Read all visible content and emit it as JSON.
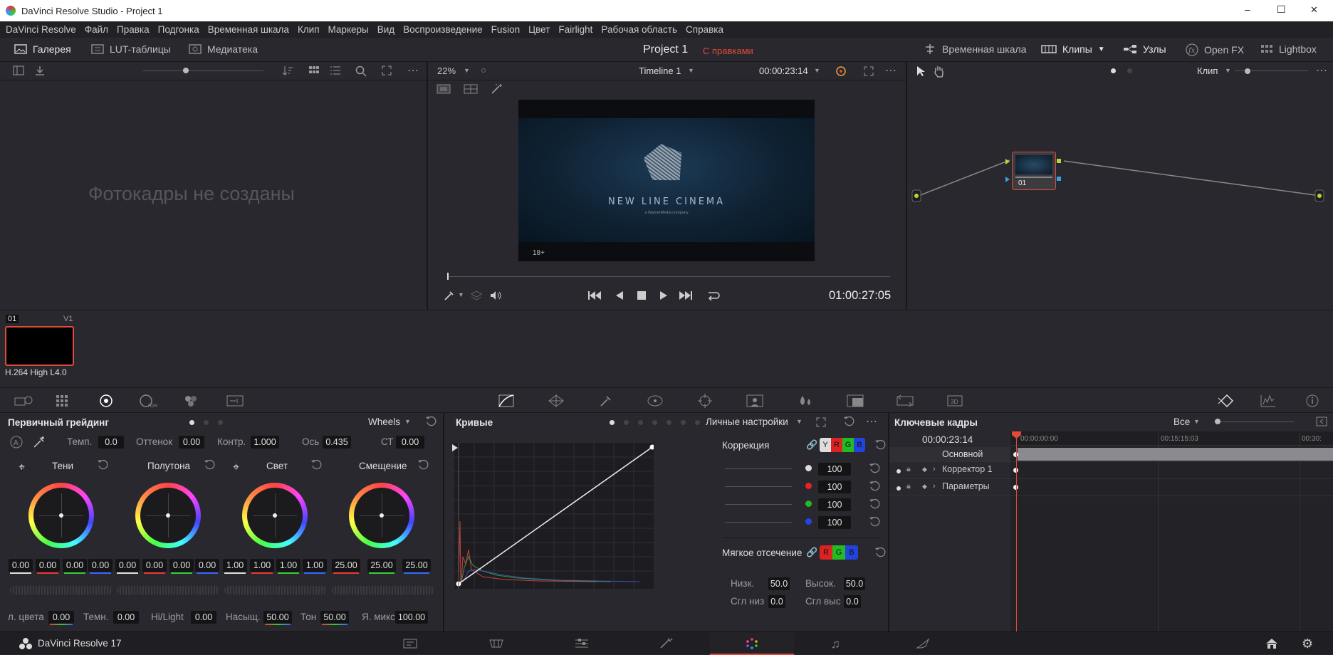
{
  "window": {
    "title": "DaVinci Resolve Studio - Project 1",
    "min": "–",
    "max": "☐",
    "close": "✕"
  },
  "menu": [
    "DaVinci Resolve",
    "Файл",
    "Правка",
    "Подгонка",
    "Временная шкала",
    "Клип",
    "Маркеры",
    "Вид",
    "Воспроизведение",
    "Fusion",
    "Цвет",
    "Fairlight",
    "Рабочая область",
    "Справка"
  ],
  "modebar": {
    "gallery": "Галерея",
    "lut": "LUT-таблицы",
    "media": "Медиатека",
    "project": "Project 1",
    "edited": "С правками",
    "timeline": "Временная шкала",
    "clips": "Клипы",
    "nodes": "Узлы",
    "openfx": "Open FX",
    "lightbox": "Lightbox"
  },
  "gallery": {
    "empty": "Фотокадры не созданы"
  },
  "viewer": {
    "zoom": "22%",
    "timeline_name": "Timeline 1",
    "timecode_top": "00:00:23:14",
    "timecode": "01:00:27:05",
    "logo": "NEW LINE CINEMA",
    "logo_sub": "a WarnerMedia company",
    "rating": "18+"
  },
  "nodes": {
    "mode": "Клип",
    "node_label": "01"
  },
  "clip": {
    "index": "01",
    "track": "V1",
    "codec": "H.264 High L4.0"
  },
  "primaries": {
    "title": "Первичный грейдинг",
    "mode": "Wheels",
    "params": [
      {
        "label": "Темп.",
        "value": "0.0"
      },
      {
        "label": "Оттенок",
        "value": "0.00"
      },
      {
        "label": "Контр.",
        "value": "1.000"
      },
      {
        "label": "Ось",
        "value": "0.435"
      },
      {
        "label": "СТ",
        "value": "0.00"
      }
    ],
    "wheels": [
      {
        "name": "Тени",
        "values": [
          "0.00",
          "0.00",
          "0.00",
          "0.00"
        ]
      },
      {
        "name": "Полутона",
        "values": [
          "0.00",
          "0.00",
          "0.00",
          "0.00"
        ]
      },
      {
        "name": "Свет",
        "values": [
          "1.00",
          "1.00",
          "1.00",
          "1.00"
        ]
      },
      {
        "name": "Смещение",
        "values": [
          "25.00",
          "25.00",
          "25.00"
        ]
      }
    ],
    "bottom": [
      {
        "label": "л. цвета",
        "value": "0.00"
      },
      {
        "label": "Темн.",
        "value": "0.00"
      },
      {
        "label": "Hi/Light",
        "value": "0.00"
      },
      {
        "label": "Насыщ.",
        "value": "50.00"
      },
      {
        "label": "Тон",
        "value": "50.00"
      },
      {
        "label": "Я. микс",
        "value": "100.00"
      }
    ]
  },
  "curves": {
    "title": "Кривые",
    "custom": "Личные настройки",
    "correction": "Коррекция",
    "channels": [
      "Y",
      "R",
      "G",
      "B"
    ],
    "levels": [
      "100",
      "100",
      "100",
      "100"
    ],
    "soft_clip": "Мягкое отсечение",
    "soft_channels": [
      "R",
      "G",
      "B"
    ],
    "low_label": "Низк.",
    "low": "50.0",
    "high_label": "Высок.",
    "high": "50.0",
    "ls_label": "Сгл низ",
    "ls": "0.0",
    "hs_label": "Сгл выс",
    "hs": "0.0"
  },
  "keyframes": {
    "title": "Ключевые кадры",
    "filter": "Все",
    "timecode": "00:00:23:14",
    "ruler": [
      "00:00:00:00",
      "00:15:15:03",
      "00:30:"
    ],
    "tracks": [
      "Основной",
      "Корректор 1",
      "Параметры"
    ]
  },
  "footer": {
    "app": "DaVinci Resolve 17"
  },
  "colors": {
    "accent": "#e04a3c",
    "bg": "#28282e",
    "panel": "#1f1f23"
  }
}
